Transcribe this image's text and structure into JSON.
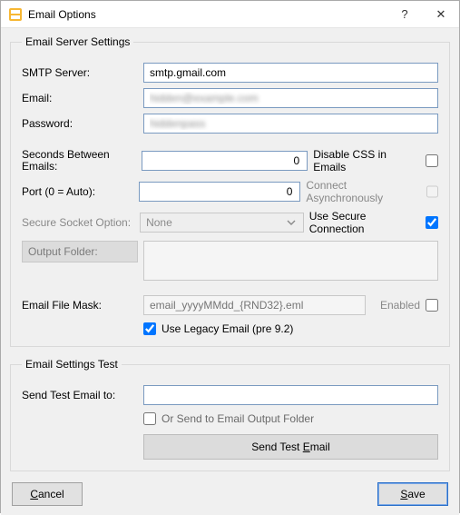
{
  "window": {
    "title": "Email Options",
    "help_glyph": "?",
    "close_glyph": "✕"
  },
  "server": {
    "legend": "Email Server Settings",
    "smtp_label": "SMTP Server:",
    "smtp_value": "smtp.gmail.com",
    "email_label": "Email:",
    "email_value": "hidden@example.com",
    "password_label": "Password:",
    "password_value": "hiddenpass",
    "seconds_label": "Seconds Between Emails:",
    "seconds_value": "0",
    "disable_css_label": "Disable CSS in Emails",
    "disable_css_checked": false,
    "port_label": "Port (0 = Auto):",
    "port_value": "0",
    "connect_async_label": "Connect Asynchronously",
    "connect_async_checked": false,
    "secure_socket_label": "Secure Socket Option:",
    "secure_socket_value": "None",
    "use_secure_label": "Use Secure Connection",
    "use_secure_checked": true,
    "output_folder_label": "Output Folder:",
    "output_folder_value": "",
    "mask_label": "Email File Mask:",
    "mask_placeholder": "email_yyyyMMdd_{RND32}.eml",
    "mask_value": "",
    "mask_enabled_label": "Enabled",
    "mask_enabled_checked": false,
    "legacy_label": "Use Legacy Email (pre 9.2)",
    "legacy_checked": true
  },
  "test": {
    "legend": "Email Settings Test",
    "send_to_label": "Send Test Email to:",
    "send_to_value": "",
    "or_label": "Or Send to Email Output Folder",
    "or_checked": false,
    "send_btn_pre": "Send Test ",
    "send_btn_u": "E",
    "send_btn_post": "mail"
  },
  "footer": {
    "cancel_u": "C",
    "cancel_post": "ancel",
    "save_u": "S",
    "save_post": "ave"
  }
}
